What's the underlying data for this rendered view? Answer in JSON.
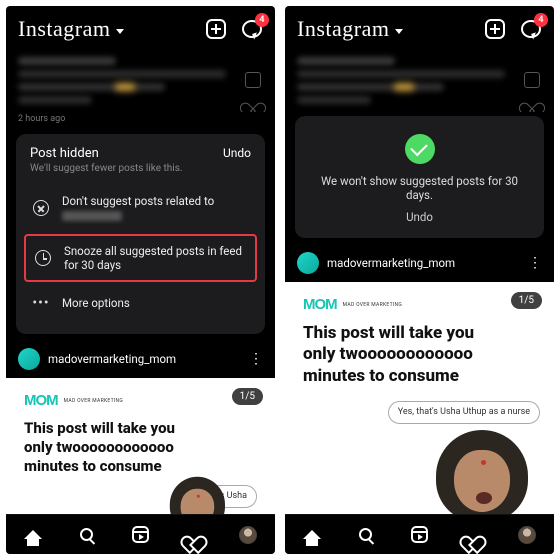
{
  "header": {
    "brand": "Instagram",
    "badge_count": "4"
  },
  "timestamp": "2 hours ago",
  "hidden_card": {
    "title": "Post hidden",
    "subtitle": "We'll suggest fewer posts like this.",
    "undo": "Undo",
    "opt_related": "Don't suggest posts related to",
    "opt_snooze": "Snooze all suggested posts in feed for 30 days",
    "opt_more": "More options"
  },
  "success_card": {
    "message": "We won't show suggested posts for 30 days.",
    "undo": "Undo"
  },
  "account": {
    "username": "madovermarketing_mom"
  },
  "post": {
    "counter": "1/5",
    "brand": "MOM",
    "brand_sub": "MAD OVER MARKETING",
    "headline_l1": "This post will take you",
    "headline_l2": "only twoooooooooooo",
    "headline_l3": "minutes to consume",
    "bubble_full": "Yes, that's Usha Uthup as a nurse",
    "bubble_crop": "Yes, that's Usha"
  }
}
